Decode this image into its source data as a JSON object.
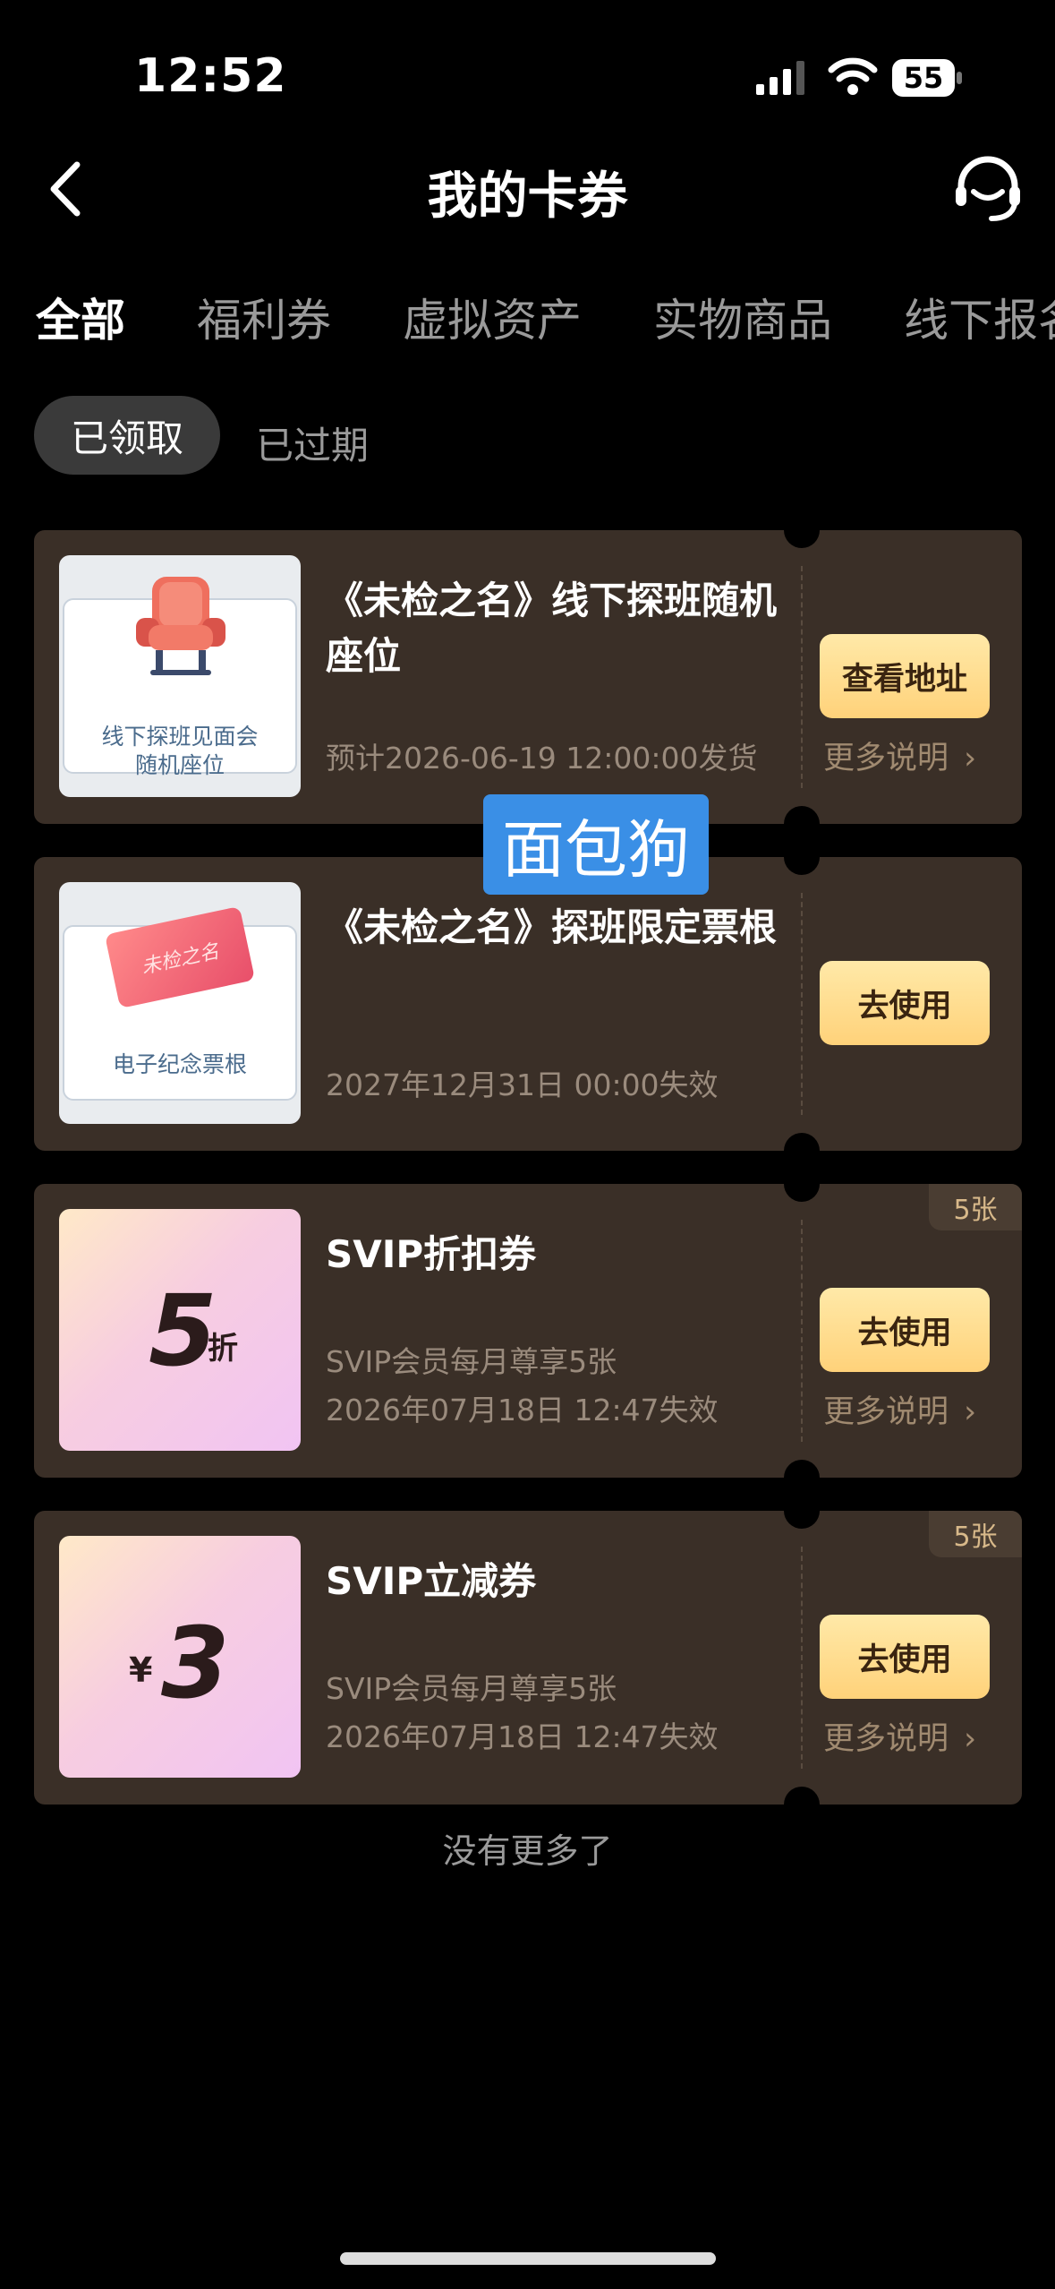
{
  "status_bar": {
    "time": "12:52",
    "battery": "55"
  },
  "header": {
    "title": "我的卡券"
  },
  "tabs": [
    {
      "label": "全部",
      "active": true
    },
    {
      "label": "福利券",
      "active": false
    },
    {
      "label": "虚拟资产",
      "active": false
    },
    {
      "label": "实物商品",
      "active": false
    },
    {
      "label": "线下报名",
      "active": false
    }
  ],
  "filters": {
    "received": "已领取",
    "expired": "已过期"
  },
  "watermark": "面包狗",
  "cards": [
    {
      "title": "《未检之名》线下探班随机座位",
      "thumb_caption_1": "线下探班见面会",
      "thumb_caption_2": "随机座位",
      "sub1": "预计2026-06-19 12:00:00发货",
      "button": "查看地址",
      "more": "更多说明"
    },
    {
      "title": "《未检之名》探班限定票根",
      "thumb_caption_1": "电子纪念票根",
      "thumb_ticket_text": "未检之名",
      "sub1": "2027年12月31日 00:00失效",
      "button": "去使用"
    },
    {
      "title": "SVIP折扣券",
      "thumb_value": "5",
      "thumb_unit": "折",
      "count": "5张",
      "sub1": "SVIP会员每月尊享5张",
      "sub2": "2026年07月18日 12:47失效",
      "button": "去使用",
      "more": "更多说明"
    },
    {
      "title": "SVIP立减券",
      "thumb_currency": "¥",
      "thumb_value": "3",
      "count": "5张",
      "sub1": "SVIP会员每月尊享5张",
      "sub2": "2026年07月18日 12:47失效",
      "button": "去使用",
      "more": "更多说明"
    }
  ],
  "footer": "没有更多了"
}
